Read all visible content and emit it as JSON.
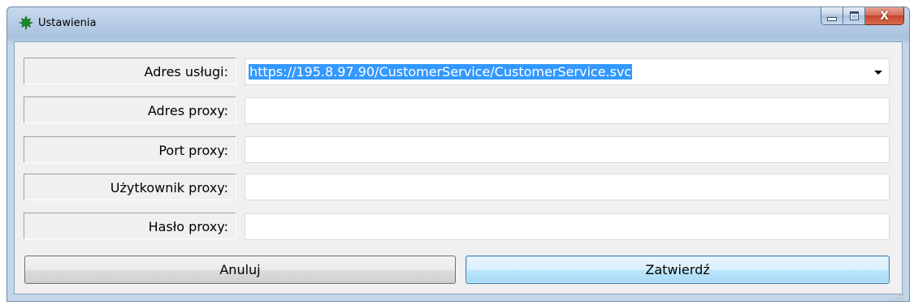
{
  "window": {
    "title": "Ustawienia",
    "icon": "maple-leaf-icon",
    "close_symbol": "X"
  },
  "form": {
    "fields": [
      {
        "label": "Adres usługi:",
        "value": "https://195.8.97.90/CustomerService/CustomerService.svc",
        "type": "combobox"
      },
      {
        "label": "Adres proxy:",
        "value": "",
        "type": "text"
      },
      {
        "label": "Port proxy:",
        "value": "",
        "type": "text"
      },
      {
        "label": "Użytkownik proxy:",
        "value": "",
        "type": "text"
      },
      {
        "label": "Hasło proxy:",
        "value": "",
        "type": "password"
      }
    ]
  },
  "buttons": {
    "cancel": "Anuluj",
    "confirm": "Zatwierdź"
  },
  "colors": {
    "selection": "#3399ff",
    "app_icon": "#1a8a2a"
  }
}
